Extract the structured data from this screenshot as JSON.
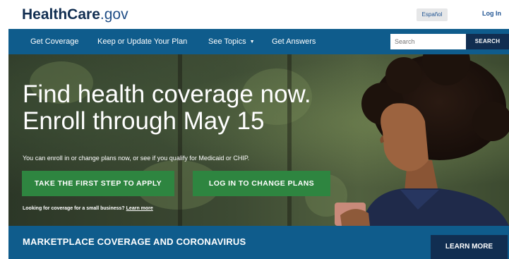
{
  "header": {
    "logo_bold": "HealthCare",
    "logo_tld": ".gov",
    "language_label": "Español",
    "login_label": "Log In"
  },
  "nav": {
    "items": [
      {
        "label": "Get Coverage"
      },
      {
        "label": "Keep or Update Your Plan"
      },
      {
        "label": "See Topics"
      },
      {
        "label": "Get Answers"
      }
    ],
    "search_placeholder": "Search",
    "search_button": "SEARCH"
  },
  "hero": {
    "title_line1": "Find health coverage now.",
    "title_line2": "Enroll through May 15",
    "subtitle": "You can enroll in or change plans now, or see if you qualify for Medicaid or CHIP.",
    "apply_button": "TAKE THE FIRST STEP TO APPLY",
    "login_button": "LOG IN TO CHANGE PLANS",
    "small_business_text": "Looking for coverage for a small business?",
    "small_business_link": "Learn more"
  },
  "banner": {
    "title": "MARKETPLACE COVERAGE AND CORONAVIRUS",
    "learn_more": "LEARN MORE"
  },
  "colors": {
    "nav_blue": "#0f5c8c",
    "dark_navy": "#112e51",
    "green": "#2e8540"
  }
}
